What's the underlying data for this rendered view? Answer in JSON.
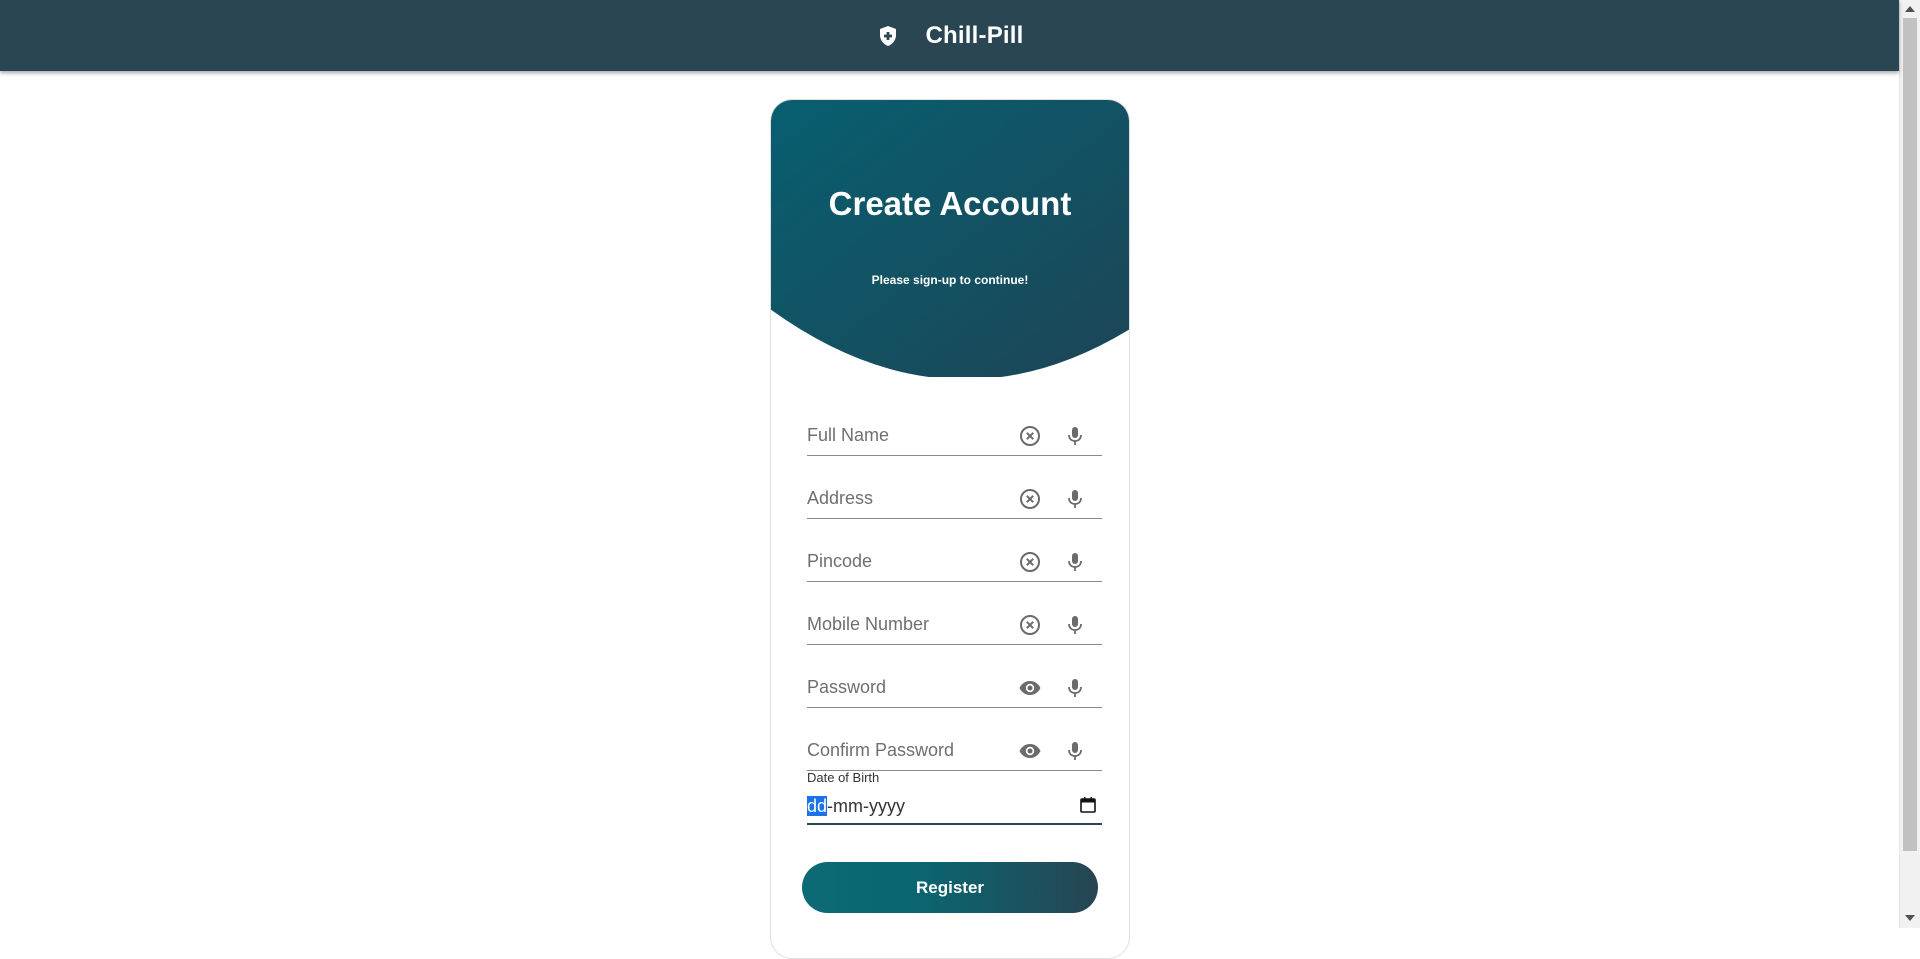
{
  "app": {
    "name": "Chill-Pill",
    "logo_icon": "shield-plus-icon",
    "bar_color": "#294652"
  },
  "header": {
    "title": "Create Account",
    "subtitle": "Please sign-up to continue!",
    "gradient": [
      "#075f70",
      "#1b4757"
    ]
  },
  "form": {
    "fields": [
      {
        "placeholder": "Full Name",
        "value": "",
        "action_icon": "clear-icon",
        "voice_icon": "microphone-icon"
      },
      {
        "placeholder": "Address",
        "value": "",
        "action_icon": "clear-icon",
        "voice_icon": "microphone-icon"
      },
      {
        "placeholder": "Pincode",
        "value": "",
        "action_icon": "clear-icon",
        "voice_icon": "microphone-icon"
      },
      {
        "placeholder": "Mobile Number",
        "value": "",
        "action_icon": "clear-icon",
        "voice_icon": "microphone-icon"
      },
      {
        "placeholder": "Password",
        "value": "",
        "action_icon": "eye-icon",
        "voice_icon": "microphone-icon"
      },
      {
        "placeholder": "Confirm Password",
        "value": "",
        "action_icon": "eye-icon",
        "voice_icon": "microphone-icon"
      }
    ],
    "dob": {
      "label": "Date of Birth",
      "selected_segment": "dd",
      "rest_placeholder": "-mm-yyyy",
      "icon": "calendar-icon"
    },
    "register_label": "Register"
  }
}
